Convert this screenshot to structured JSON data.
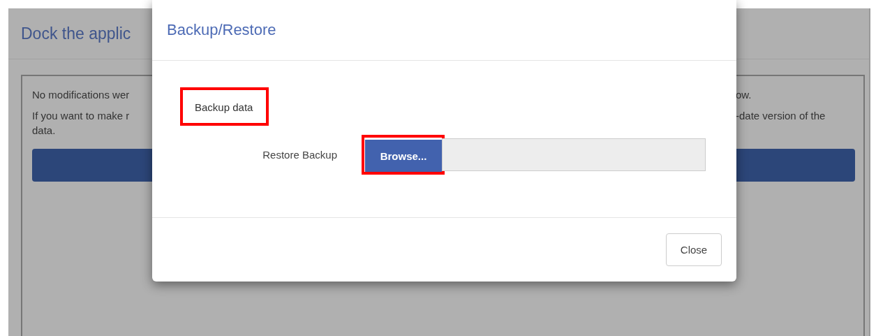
{
  "page": {
    "title": "Dock the applic",
    "lines": [
      {
        "left": "No modifications wer",
        "right": "ow."
      },
      {
        "left": "If you want to make r",
        "right": "-date version of the"
      },
      {
        "left": "data."
      }
    ]
  },
  "dialog": {
    "title": "Backup/Restore",
    "section": {
      "label": "Backup data",
      "highlighted": true
    },
    "restore": {
      "label": "Restore Backup",
      "button": "Browse...",
      "highlighted": true
    },
    "buttons": [
      "Close"
    ]
  }
}
